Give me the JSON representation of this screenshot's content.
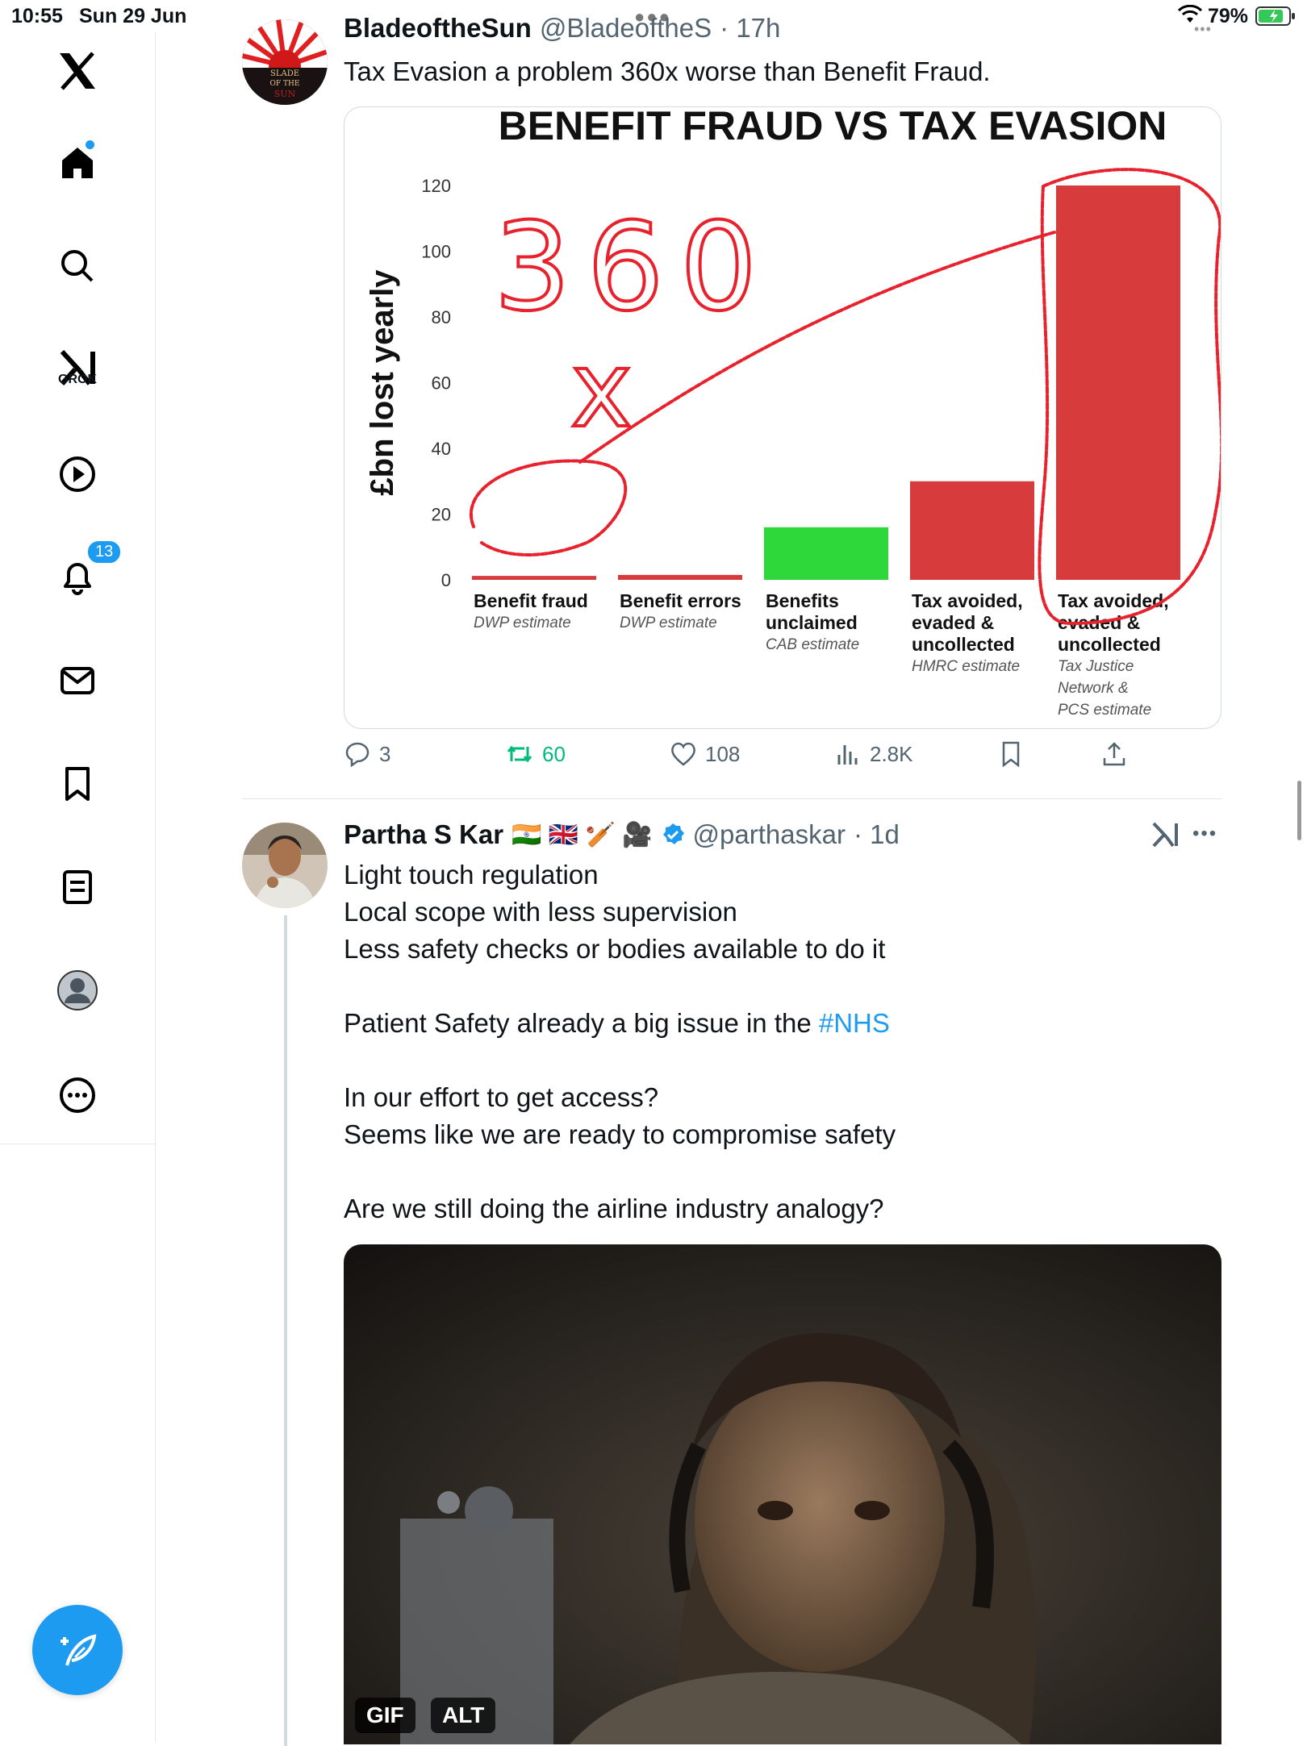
{
  "status_bar": {
    "time": "10:55",
    "date": "Sun 29 Jun",
    "battery": "79%"
  },
  "sidebar": {
    "items": [
      {
        "name": "x-logo"
      },
      {
        "name": "home"
      },
      {
        "name": "search"
      },
      {
        "name": "grok",
        "label": "GROK"
      },
      {
        "name": "video"
      },
      {
        "name": "notifications",
        "badge": "13"
      },
      {
        "name": "messages"
      },
      {
        "name": "bookmarks"
      },
      {
        "name": "lists"
      },
      {
        "name": "profile"
      },
      {
        "name": "more"
      }
    ]
  },
  "tweet1": {
    "name": "BladeoftheSun",
    "handle": "@BladeoftheS",
    "time": "· 17h",
    "avatar_text": [
      "SLADE",
      "OF THE",
      "SUN"
    ],
    "text": "Tax Evasion a problem 360x worse than Benefit Fraud.",
    "actions": {
      "replies": "3",
      "reposts": "60",
      "likes": "108",
      "views": "2.8K"
    }
  },
  "chart_data": {
    "type": "bar",
    "title": "BENEFIT FRAUD VS TAX EVASION",
    "ylabel": "£bn lost yearly",
    "ylim": [
      0,
      120
    ],
    "yticks": [
      "0",
      "20",
      "40",
      "60",
      "80",
      "100",
      "120"
    ],
    "categories": [
      {
        "label": [
          "Benefit fraud"
        ],
        "source": [
          "DWP estimate"
        ]
      },
      {
        "label": [
          "Benefit errors"
        ],
        "source": [
          "DWP estimate"
        ]
      },
      {
        "label": [
          "Benefits",
          "unclaimed"
        ],
        "source": [
          "CAB estimate"
        ]
      },
      {
        "label": [
          "Tax avoided,",
          "evaded &",
          "uncollected"
        ],
        "source": [
          "HMRC estimate"
        ]
      },
      {
        "label": [
          "Tax avoided,",
          "evaded &",
          "uncollected"
        ],
        "source": [
          "Tax Justice",
          "Network &",
          "PCS estimate"
        ]
      }
    ],
    "values": [
      1.2,
      1.5,
      16,
      30,
      120
    ],
    "bar_colors": [
      "#d83b3b",
      "#d83b3b",
      "#2fd83a",
      "#d83b3b",
      "#d83b3b"
    ],
    "annotation": "360x"
  },
  "tweet2": {
    "name": "Partha S Kar",
    "flags": "🇮🇳 🇬🇧 🏏 🎥",
    "handle": "@parthaskar",
    "time": "· 1d",
    "lines": [
      "Light touch regulation",
      "Local scope with less supervision",
      "Less safety checks or bodies available to do it",
      "",
      "Patient Safety already a big issue in the ",
      "",
      "In our effort to get access?",
      "Seems like we are ready to compromise safety",
      "",
      "Are we still doing the airline industry analogy?"
    ],
    "hashtag": "#NHS",
    "gif_label": "GIF",
    "alt_label": "ALT"
  },
  "colors": {
    "accent": "#1d9bf0",
    "repost": "#00ba7c",
    "text_secondary": "#536471"
  }
}
